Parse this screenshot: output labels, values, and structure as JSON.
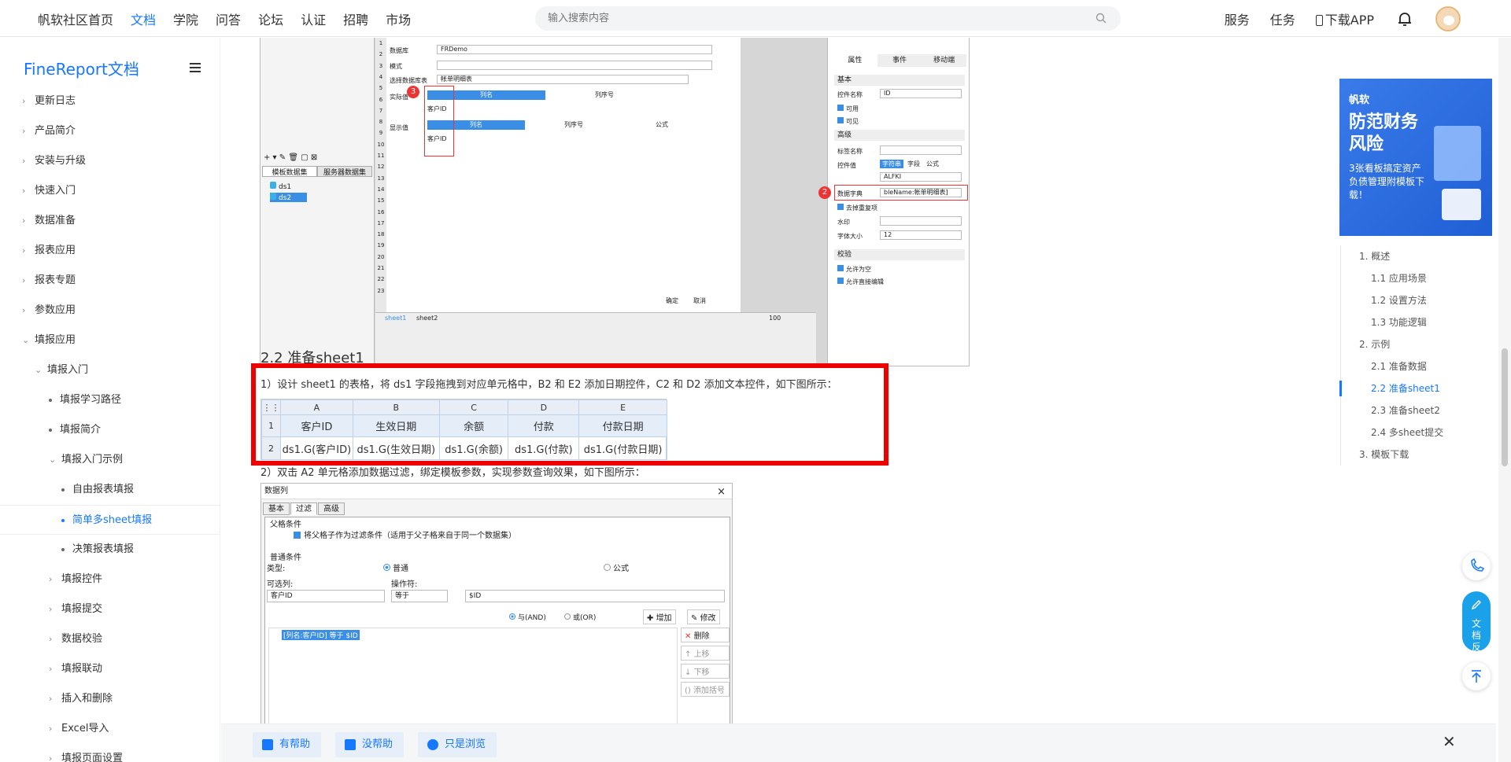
{
  "nav": {
    "items": [
      "帆软社区首页",
      "文档",
      "学院",
      "问答",
      "论坛",
      "认证",
      "招聘",
      "市场"
    ],
    "active": "文档",
    "search_placeholder": "输入搜索内容",
    "right": [
      "服务",
      "任务",
      "下载APP"
    ]
  },
  "sidebar": {
    "brand": "FineReport文档",
    "items": [
      {
        "label": "更新日志",
        "level": 1,
        "arrow": "›"
      },
      {
        "label": "产品简介",
        "level": 1,
        "arrow": "›"
      },
      {
        "label": "安装与升级",
        "level": 1,
        "arrow": "›"
      },
      {
        "label": "快速入门",
        "level": 1,
        "arrow": "›"
      },
      {
        "label": "数据准备",
        "level": 1,
        "arrow": "›"
      },
      {
        "label": "报表应用",
        "level": 1,
        "arrow": "›"
      },
      {
        "label": "报表专题",
        "level": 1,
        "arrow": "›"
      },
      {
        "label": "参数应用",
        "level": 1,
        "arrow": "›"
      },
      {
        "label": "填报应用",
        "level": 1,
        "arrow": "⌄"
      },
      {
        "label": "填报入门",
        "level": 2,
        "arrow": "⌄"
      },
      {
        "label": "填报学习路径",
        "level": 3,
        "arrow": "dot"
      },
      {
        "label": "填报简介",
        "level": 3,
        "arrow": "dot"
      },
      {
        "label": "填报入门示例",
        "level": 3,
        "arrow": "⌄"
      },
      {
        "label": "自由报表填报",
        "level": 4,
        "arrow": "dot"
      },
      {
        "label": "简单多sheet填报",
        "level": 4,
        "arrow": "dot",
        "active": true
      },
      {
        "label": "决策报表填报",
        "level": 4,
        "arrow": "dot"
      },
      {
        "label": "填报控件",
        "level": 3,
        "arrow": "›"
      },
      {
        "label": "填报提交",
        "level": 3,
        "arrow": "›"
      },
      {
        "label": "数据校验",
        "level": 3,
        "arrow": "›"
      },
      {
        "label": "填报联动",
        "level": 3,
        "arrow": "›"
      },
      {
        "label": "插入和删除",
        "level": 3,
        "arrow": "›"
      },
      {
        "label": "Excel导入",
        "level": 3,
        "arrow": "›"
      },
      {
        "label": "填报页面设置",
        "level": 3,
        "arrow": "›"
      }
    ]
  },
  "content": {
    "heading": "2.2 准备sheet1",
    "p1": "1）设计 sheet1 的表格，将 ds1 字段拖拽到对应单元格中，B2 和 E2 添加日期控件，C2 和 D2 添加文本控件，如下图所示：",
    "p2": "2）双击 A2 单元格添加数据过滤，绑定模板参数，实现参数查询效果，如下图所示：",
    "sheet": {
      "cols": [
        "A",
        "B",
        "C",
        "D",
        "E"
      ],
      "rows": [
        {
          "n": "1",
          "cells": [
            "客户ID",
            "生效日期",
            "余额",
            "付款",
            "付款日期"
          ]
        },
        {
          "n": "2",
          "cells": [
            "ds1.G(客户ID)",
            "ds1.G(生效日期)",
            "ds1.G(余额)",
            "ds1.G(付款)",
            "ds1.G(付款日期)"
          ]
        }
      ]
    },
    "top_screenshot": {
      "rows": [
        "1",
        "2",
        "3",
        "4",
        "5",
        "6",
        "7",
        "8",
        "9",
        "10",
        "11",
        "12",
        "13",
        "14",
        "15",
        "16",
        "17",
        "18",
        "19",
        "20",
        "21",
        "22",
        "23"
      ],
      "labels": {
        "dataset_template": "模板数据集",
        "dataset_server": "服务器数据集",
        "ds1": "ds1",
        "ds2": "ds2",
        "field_db": "数据库",
        "db_val": "FRDemo",
        "mode": "模式",
        "table_label": "选择数据库表",
        "table_val": "帐单明细表",
        "actual": "实际值",
        "col_name": "列名",
        "col_seq": "列序号",
        "customer_id": "客户ID",
        "display": "显示值",
        "formula": "公式",
        "ok": "确定",
        "cancel": "取消",
        "sheet1": "sheet1",
        "sheet2": "sheet2",
        "zoom": "100"
      },
      "badge_a": "3",
      "badge_b": "2",
      "props": {
        "tabs": [
          "属性",
          "事件",
          "移动端"
        ],
        "basic": "基本",
        "name_label": "控件名称",
        "name_val": "ID",
        "enabled": "可用",
        "visible": "可见",
        "advanced": "高级",
        "tag_name": "标签名称",
        "ctrl_val": "控件值",
        "opt_str": "字符串",
        "opt_field": "字段",
        "opt_formula": "公式",
        "ctrl_text": "ALFKI",
        "dict_label": "数据字典",
        "dict_val": "bleName:帐单明细表]",
        "dedup": "去掉重复项",
        "water": "水印",
        "font_size": "字体大小",
        "font_val": "12",
        "check": "校验",
        "allow_empty": "允许为空",
        "allow_edit": "允许直接编辑"
      }
    },
    "dialog": {
      "title": "数据列",
      "tabs": [
        "基本",
        "过滤",
        "高级"
      ],
      "parent_cond": "父格条件",
      "parent_cb": "将父格子作为过滤条件（适用于父子格来自于同一个数据集）",
      "normal_cond": "普通条件",
      "type_label": "类型:",
      "type_normal": "普通",
      "type_formula": "公式",
      "col_label": "可选列:",
      "op_label": "操作符:",
      "col_val": "客户ID",
      "op_val": "等于",
      "param_val": "$ID",
      "and": "与(AND)",
      "or": "或(OR)",
      "add": "增加",
      "modify": "修改",
      "delete": "删除",
      "up": "上移",
      "down": "下移",
      "bracket": "添加括号",
      "condition": "[列名:客户ID] 等于 $ID"
    }
  },
  "toc": [
    {
      "label": "1. 概述",
      "level": 1
    },
    {
      "label": "1.1 应用场景",
      "level": 2
    },
    {
      "label": "1.2 设置方法",
      "level": 2
    },
    {
      "label": "1.3 功能逻辑",
      "level": 2
    },
    {
      "label": "2. 示例",
      "level": 1
    },
    {
      "label": "2.1 准备数据",
      "level": 2
    },
    {
      "label": "2.2 准备sheet1",
      "level": 2,
      "active": true
    },
    {
      "label": "2.3 准备sheet2",
      "level": 2
    },
    {
      "label": "2.4 多sheet提交",
      "level": 2
    },
    {
      "label": "3. 模板下载",
      "level": 1
    }
  ],
  "ad": {
    "logo": "帆软",
    "title": "防范财务风险",
    "sub": "3张看板搞定资产负债管理附模板下载！"
  },
  "feedback": {
    "helpful": "有帮助",
    "unhelpful": "没帮助",
    "browse": "只是浏览",
    "side": "文档反馈"
  },
  "colors": {
    "accent": "#1677ff",
    "highlight": "#e00000"
  }
}
